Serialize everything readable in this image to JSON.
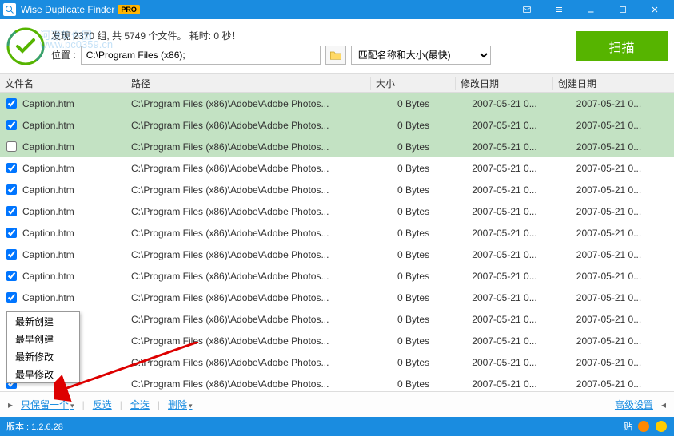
{
  "app": {
    "title": "Wise Duplicate Finder",
    "pro_badge": "PRO"
  },
  "header": {
    "stats": "发现 2370 组, 共 5749 个文件。 耗时: 0 秒！",
    "watermark_line1": "河源软件园",
    "watermark_line2": "www.pc0359.cn",
    "location_label": "位置",
    "location_value": "C:\\Program Files (x86);",
    "match_option": "匹配名称和大小(最快)",
    "scan_label": "扫描"
  },
  "columns": {
    "name": "文件名",
    "path": "路径",
    "size": "大小",
    "modified": "修改日期",
    "created": "创建日期"
  },
  "rows": [
    {
      "checked": true,
      "group": 0,
      "name": "Caption.htm",
      "path": "C:\\Program Files (x86)\\Adobe\\Adobe Photos...",
      "size": "0 Bytes",
      "modified": "2007-05-21 0...",
      "created": "2007-05-21 0..."
    },
    {
      "checked": true,
      "group": 0,
      "name": "Caption.htm",
      "path": "C:\\Program Files (x86)\\Adobe\\Adobe Photos...",
      "size": "0 Bytes",
      "modified": "2007-05-21 0...",
      "created": "2007-05-21 0..."
    },
    {
      "checked": false,
      "group": 0,
      "name": "Caption.htm",
      "path": "C:\\Program Files (x86)\\Adobe\\Adobe Photos...",
      "size": "0 Bytes",
      "modified": "2007-05-21 0...",
      "created": "2007-05-21 0..."
    },
    {
      "checked": true,
      "group": 1,
      "name": "Caption.htm",
      "path": "C:\\Program Files (x86)\\Adobe\\Adobe Photos...",
      "size": "0 Bytes",
      "modified": "2007-05-21 0...",
      "created": "2007-05-21 0..."
    },
    {
      "checked": true,
      "group": 1,
      "name": "Caption.htm",
      "path": "C:\\Program Files (x86)\\Adobe\\Adobe Photos...",
      "size": "0 Bytes",
      "modified": "2007-05-21 0...",
      "created": "2007-05-21 0..."
    },
    {
      "checked": true,
      "group": 1,
      "name": "Caption.htm",
      "path": "C:\\Program Files (x86)\\Adobe\\Adobe Photos...",
      "size": "0 Bytes",
      "modified": "2007-05-21 0...",
      "created": "2007-05-21 0..."
    },
    {
      "checked": true,
      "group": 1,
      "name": "Caption.htm",
      "path": "C:\\Program Files (x86)\\Adobe\\Adobe Photos...",
      "size": "0 Bytes",
      "modified": "2007-05-21 0...",
      "created": "2007-05-21 0..."
    },
    {
      "checked": true,
      "group": 1,
      "name": "Caption.htm",
      "path": "C:\\Program Files (x86)\\Adobe\\Adobe Photos...",
      "size": "0 Bytes",
      "modified": "2007-05-21 0...",
      "created": "2007-05-21 0..."
    },
    {
      "checked": true,
      "group": 1,
      "name": "Caption.htm",
      "path": "C:\\Program Files (x86)\\Adobe\\Adobe Photos...",
      "size": "0 Bytes",
      "modified": "2007-05-21 0...",
      "created": "2007-05-21 0..."
    },
    {
      "checked": true,
      "group": 1,
      "name": "Caption.htm",
      "path": "C:\\Program Files (x86)\\Adobe\\Adobe Photos...",
      "size": "0 Bytes",
      "modified": "2007-05-21 0...",
      "created": "2007-05-21 0..."
    },
    {
      "checked": true,
      "group": 1,
      "name": "",
      "path": "C:\\Program Files (x86)\\Adobe\\Adobe Photos...",
      "size": "0 Bytes",
      "modified": "2007-05-21 0...",
      "created": "2007-05-21 0..."
    },
    {
      "checked": true,
      "group": 1,
      "name": "",
      "path": "C:\\Program Files (x86)\\Adobe\\Adobe Photos...",
      "size": "0 Bytes",
      "modified": "2007-05-21 0...",
      "created": "2007-05-21 0..."
    },
    {
      "checked": true,
      "group": 1,
      "name": "",
      "path": "C:\\Program Files (x86)\\Adobe\\Adobe Photos...",
      "size": "0 Bytes",
      "modified": "2007-05-21 0...",
      "created": "2007-05-21 0..."
    },
    {
      "checked": true,
      "group": 1,
      "name": "",
      "path": "C:\\Program Files (x86)\\Adobe\\Adobe Photos...",
      "size": "0 Bytes",
      "modified": "2007-05-21 0...",
      "created": "2007-05-21 0..."
    }
  ],
  "context_menu": {
    "items": [
      "最新创建",
      "最早创建",
      "最新修改",
      "最早修改"
    ]
  },
  "bottom": {
    "keep_one": "只保留一个",
    "invert": "反选",
    "select_all": "全选",
    "delete": "删除",
    "advanced": "高级设置"
  },
  "statusbar": {
    "version_label": "版本",
    "version_value": "1.2.6.28",
    "tie_label": "贴"
  }
}
